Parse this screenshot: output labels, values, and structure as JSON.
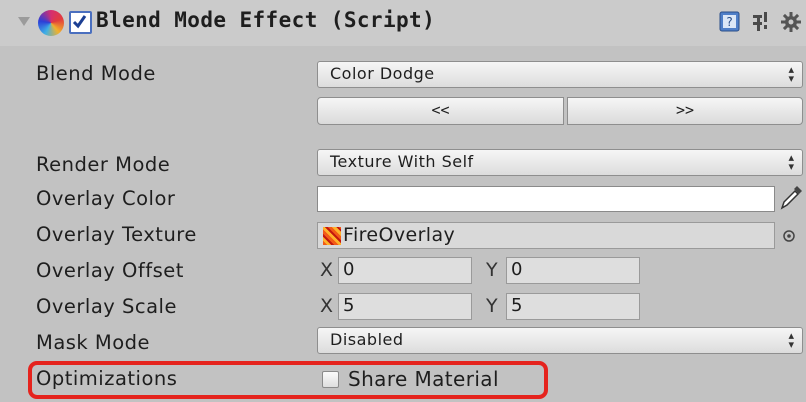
{
  "component": {
    "title": "Blend Mode Effect (Script)",
    "enabled": true,
    "icons": [
      "help-icon",
      "presets-icon",
      "gear-icon"
    ]
  },
  "fields": {
    "blend_mode": {
      "label": "Blend Mode",
      "value": "Color Dodge"
    },
    "nav_buttons": {
      "prev": "<<",
      "next": ">>"
    },
    "render_mode": {
      "label": "Render Mode",
      "value": "Texture With Self"
    },
    "overlay_color": {
      "label": "Overlay Color",
      "value": "#ffffff"
    },
    "overlay_texture": {
      "label": "Overlay Texture",
      "value": "FireOverlay"
    },
    "overlay_offset": {
      "label": "Overlay Offset",
      "x_label": "X",
      "x": "0",
      "y_label": "Y",
      "y": "0"
    },
    "overlay_scale": {
      "label": "Overlay Scale",
      "x_label": "X",
      "x": "5",
      "y_label": "Y",
      "y": "5"
    },
    "mask_mode": {
      "label": "Mask Mode",
      "value": "Disabled"
    },
    "optimizations": {
      "label": "Optimizations",
      "option_label": "Share Material",
      "checked": false
    }
  },
  "colors": {
    "highlight": "#e5231d",
    "inspector_bg": "#c2c2c2"
  }
}
